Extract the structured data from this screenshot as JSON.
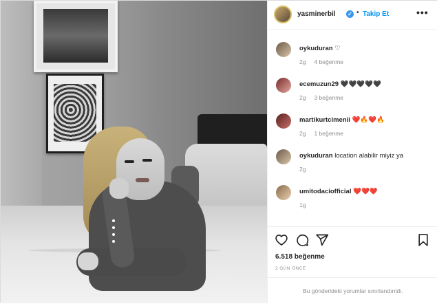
{
  "post": {
    "author": "yasminerbil",
    "verified_icon": "verified-badge-icon",
    "separator": "•",
    "follow_label": "Takip Et",
    "more_label": "•••"
  },
  "comments": [
    {
      "user": "oykuduran",
      "text": "♡",
      "time": "2g",
      "likes": "4 beğenme"
    },
    {
      "user": "ecemuzun29",
      "text": "🖤🖤🖤🖤🖤",
      "time": "2g",
      "likes": "3 beğenme"
    },
    {
      "user": "martikurtcimenii",
      "text": "❤️🔥❤️🔥",
      "time": "2g",
      "likes": "1 beğenme"
    },
    {
      "user": "oykuduran",
      "text": "location alabilir miyiz ya",
      "time": "2g",
      "likes": ""
    },
    {
      "user": "umitodaciofficial",
      "text": "❤️❤️❤️",
      "time": "1g",
      "likes": ""
    }
  ],
  "stats": {
    "likes": "6.518 beğenme",
    "time_ago": "2 GÜN ÖNCE"
  },
  "footer": {
    "comments_limited": "Bu gönderideki yorumlar sınırlandırıldı."
  },
  "colors": {
    "accent": "#0095f6",
    "text": "#262626",
    "muted": "#8e8e8e",
    "border": "#efefef"
  },
  "icons": [
    "like-heart-icon",
    "comment-bubble-icon",
    "share-paper-plane-icon",
    "save-bookmark-icon",
    "comment-like-heart-icon"
  ]
}
